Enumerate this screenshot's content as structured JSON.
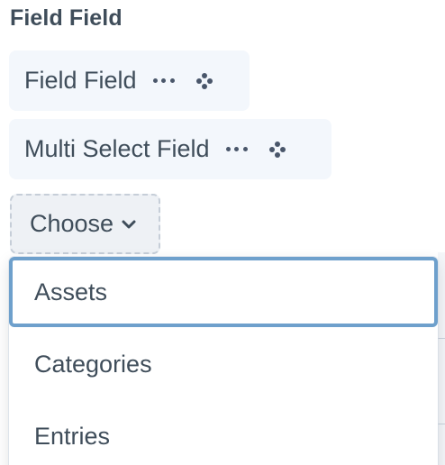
{
  "heading": "Field Field",
  "fields": [
    {
      "label": "Field Field",
      "more_icon": "ellipsis-icon",
      "move_icon": "move-icon"
    },
    {
      "label": "Multi Select Field",
      "more_icon": "ellipsis-icon",
      "move_icon": "move-icon"
    }
  ],
  "choose_button": {
    "label": "Choose",
    "icon": "chevron-down-icon"
  },
  "dropdown": {
    "items": [
      {
        "label": "Assets",
        "focused": true
      },
      {
        "label": "Categories"
      },
      {
        "label": "Entries"
      }
    ]
  },
  "colors": {
    "text": "#3f4d5a",
    "chip_bg": "#f3f7fc",
    "focus_border": "#6ea0cc",
    "dashed_border": "#c6ced8"
  }
}
